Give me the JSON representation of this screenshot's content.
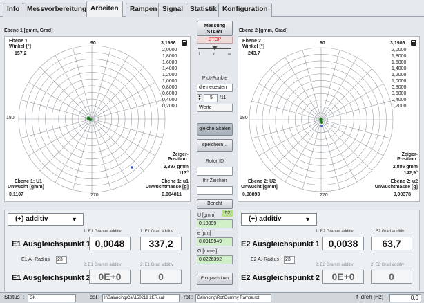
{
  "tabs": [
    {
      "label": "Info",
      "active": false
    },
    {
      "label": "Messvorbereitung",
      "active": false
    },
    {
      "label": "Arbeiten",
      "active": true
    },
    {
      "label": "Rampen",
      "active": false
    },
    {
      "label": "Signal",
      "active": false
    },
    {
      "label": "Statistik",
      "active": false
    },
    {
      "label": "Konfiguration",
      "active": false
    }
  ],
  "left_plot": {
    "title": "Ebene 1 [gmm, Grad]",
    "winkel_label_1": "Ebene 1",
    "winkel_label_2": "Winkel [°]",
    "winkel_value": "157,2",
    "scale_top": "3,1986",
    "scale_labels": [
      "2,0000",
      "1,8000",
      "1,6000",
      "1,4000",
      "1,2000",
      "1,0000",
      "0,8000",
      "0,6000",
      "0,4000",
      "0,2000"
    ],
    "angle_labels": {
      "top": "90",
      "left": "180",
      "bottom": "270"
    },
    "zeiger_label": "Zeiger-\nPosition:",
    "zeiger_value": "2,397 gmm",
    "zeiger_angle": "113°",
    "u_label_1": "Ebene 1: U1",
    "u_label_2": "Unwucht [gmm]",
    "u_value": "0,1107",
    "m_label_1": "Ebene 1: u1",
    "m_label_2": "Unwuchtmasse [g]",
    "m_value": "0,004811"
  },
  "right_plot": {
    "title": "Ebene 2 [gmm, Grad]",
    "winkel_label_1": "Ebene 2",
    "winkel_label_2": "Winkel [°]",
    "winkel_value": "243,7",
    "scale_top": "3,1986",
    "scale_labels": [
      "2,0000",
      "1,8000",
      "1,6000",
      "1,4000",
      "1,2000",
      "1,0000",
      "0,8000",
      "0,6000",
      "0,4000",
      "0,2000"
    ],
    "angle_labels": {
      "top": "90",
      "left": "180",
      "bottom": "270"
    },
    "zeiger_label": "Zeiger-\nPosition:",
    "zeiger_value": "2,886 gmm",
    "zeiger_angle": "142,9°",
    "u_label_1": "Ebene 2: U2",
    "u_label_2": "Unwucht [gmm]",
    "u_value": "0,08893",
    "m_label_1": "Ebene 2: u2",
    "m_label_2": "Unwuchtmasse [g]",
    "m_value": "0,00378"
  },
  "center": {
    "messung_label": "Messung",
    "start_label": "START",
    "stop_label": "STOP",
    "slider_ticks": [
      "1",
      "n",
      "∞"
    ],
    "plot_punkte_label": "Plot-Punkte",
    "plot_punkte_mode": "die neuesten",
    "plot_punkte_count": "5",
    "plot_punkte_total": "/11",
    "werte_label": "Werte",
    "gleiche_skalen_label": "gleiche Skalen",
    "speichern_label": "speichern...",
    "rotor_id_label": "Rotor ID",
    "rotor_id_value": "",
    "ihr_zeichen_label": "Ihr Zeichen",
    "ihr_zeichen_value": "",
    "bericht_label": "Bericht",
    "indicator_value": "52",
    "u_label": "U [gmm]",
    "u_value": "0,18399",
    "e_label": "e [µm]",
    "e_value": "0,0919949",
    "g_label": "G [mm/s]",
    "g_value": "0,0226392",
    "fortgeschritten_label": "Fortgeschritten"
  },
  "left_bottom": {
    "mode": "(+) additiv",
    "hdr_gramm_1": "1: E1 Gramm additiv",
    "hdr_grad_1": "1: E1 Grad additiv",
    "point1_label": "E1 Ausgleichspunkt 1",
    "point1_gramm": "0,0048",
    "point1_grad": "337,2",
    "radius_label": "E1 A.-Radius",
    "radius_value": "23",
    "hdr_gramm_2": "2: E1 Gramm additiv",
    "hdr_grad_2": "2: E1 Grad additiv",
    "point2_label": "E1 Ausgleichspunkt 2",
    "point2_gramm": "0E+0",
    "point2_grad": "0"
  },
  "right_bottom": {
    "mode": "(+) additiv",
    "hdr_gramm_1": "1: E2 Gramm additiv",
    "hdr_grad_1": "1: E2 Grad additiv",
    "point1_label": "E2 Ausgleichspunkt 1",
    "point1_gramm": "0,0038",
    "point1_grad": "63,7",
    "radius_label": "E2 A.-Radius",
    "radius_value": "23",
    "hdr_gramm_2": "2: E2 Gramm additiv",
    "hdr_grad_2": "2: E2 Grad additiv",
    "point2_label": "E2 Ausgleichspunkt 2",
    "point2_gramm": "0E+0",
    "point2_grad": "0"
  },
  "status": {
    "status_label": "Status",
    "status_value": "OK",
    "cal_label": "cal",
    "cal_value": "I:\\Balancing\\Cal\\150219 2ER.cal",
    "rot_label": "rot",
    "rot_value": "Balancing\\Rot\\Dummy Rampe.rot",
    "fdreh_label": "f_dreh [Hz]",
    "fdreh_value": "0,0"
  },
  "colors": {
    "accent_green": "#1e7a1e",
    "stop_red": "#d02020",
    "point_blue": "#3355cc"
  }
}
